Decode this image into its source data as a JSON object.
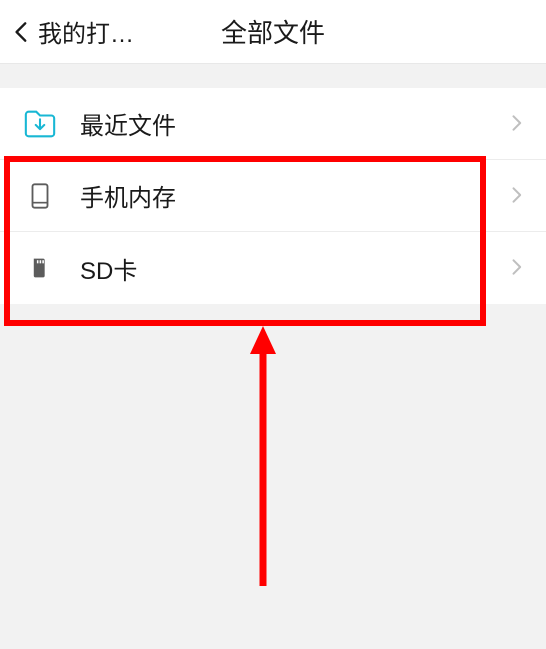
{
  "header": {
    "back_label": "我的打…",
    "title": "全部文件"
  },
  "list": {
    "items": [
      {
        "label": "最近文件",
        "icon": "download-folder-icon"
      },
      {
        "label": "手机内存",
        "icon": "phone-icon"
      },
      {
        "label": "SD卡",
        "icon": "sdcard-icon"
      }
    ]
  }
}
